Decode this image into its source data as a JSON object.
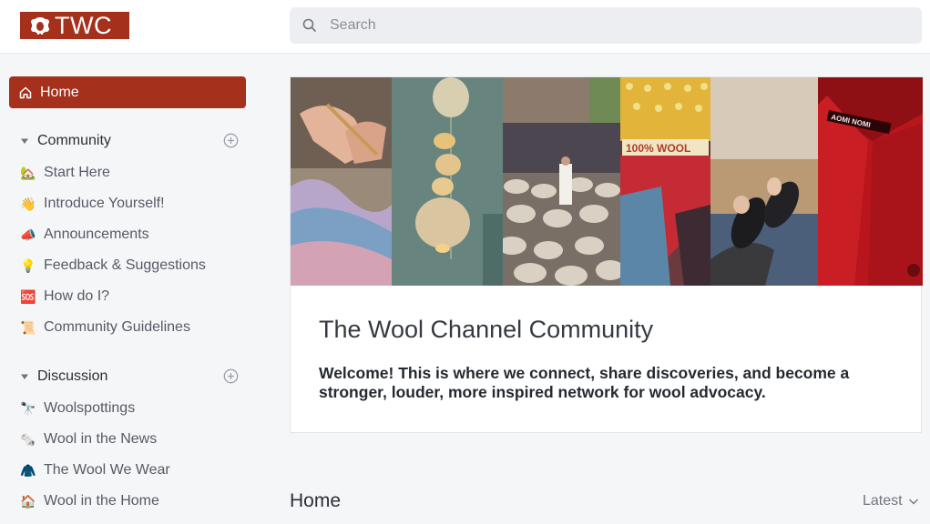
{
  "header": {
    "logo_text": "TWC",
    "search_placeholder": "Search"
  },
  "sidebar": {
    "home_label": "Home",
    "sections": [
      {
        "label": "Community",
        "items": [
          {
            "emoji": "🏡",
            "label": "Start Here"
          },
          {
            "emoji": "👋",
            "label": "Introduce Yourself!"
          },
          {
            "emoji": "📣",
            "label": "Announcements"
          },
          {
            "emoji": "💡",
            "label": "Feedback & Suggestions"
          },
          {
            "emoji": "🆘",
            "label": "How do I?"
          },
          {
            "emoji": "📜",
            "label": "Community Guidelines"
          }
        ]
      },
      {
        "label": "Discussion",
        "items": [
          {
            "emoji": "🔭",
            "label": "Woolspottings"
          },
          {
            "emoji": "🗞️",
            "label": "Wool in the News"
          },
          {
            "emoji": "🧥",
            "label": "The Wool We Wear"
          },
          {
            "emoji": "🏠",
            "label": "Wool in the Home"
          }
        ]
      }
    ]
  },
  "hero": {
    "title": "The Wool Channel Community",
    "description": "Welcome! This is where we connect, share discoveries, and become a stronger, louder, more inspired network for wool advocacy.",
    "banner_captions": [
      "100% WOOL",
      "AOMI NOMI"
    ]
  },
  "feed": {
    "title": "Home",
    "sort_label": "Latest"
  },
  "colors": {
    "brand": "#a5301c",
    "background": "#f5f6f8"
  }
}
